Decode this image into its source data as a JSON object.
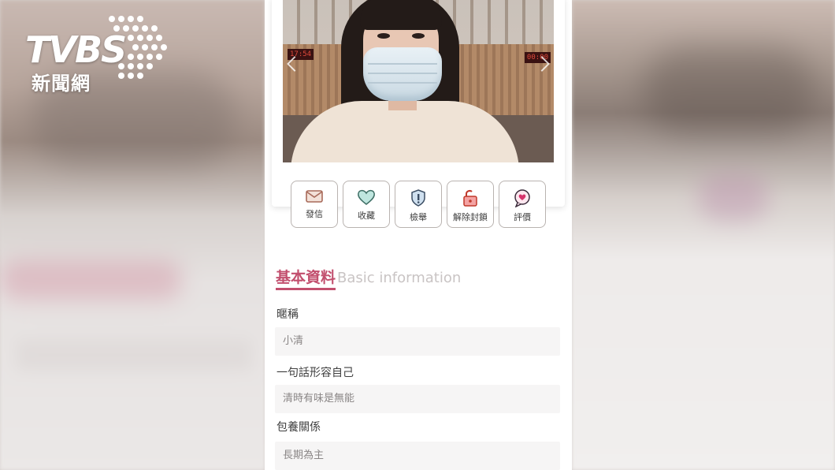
{
  "logo": {
    "word": "TVBS",
    "sub": "新聞網"
  },
  "profile": {
    "clock_left": "17:54",
    "clock_right": "00:00"
  },
  "actions": [
    {
      "label": "發信",
      "icon": "envelope-icon"
    },
    {
      "label": "收藏",
      "icon": "heart-icon"
    },
    {
      "label": "檢舉",
      "icon": "shield-icon"
    },
    {
      "label": "解除封鎖",
      "icon": "unlock-icon"
    },
    {
      "label": "評價",
      "icon": "heart-bubble-icon"
    }
  ],
  "basic_info": {
    "title_zh": "基本資料",
    "title_en": "Basic information",
    "fields": [
      {
        "label": "暱稱",
        "value": "小清"
      },
      {
        "label": "一句話形容自己",
        "value": "清時有味是無能"
      },
      {
        "label": "包養關係",
        "value": "長期為主"
      }
    ]
  },
  "colors": {
    "accent": "#c24f6e",
    "field_bg": "#f6f5f5",
    "button_border": "#b9b3b0"
  }
}
